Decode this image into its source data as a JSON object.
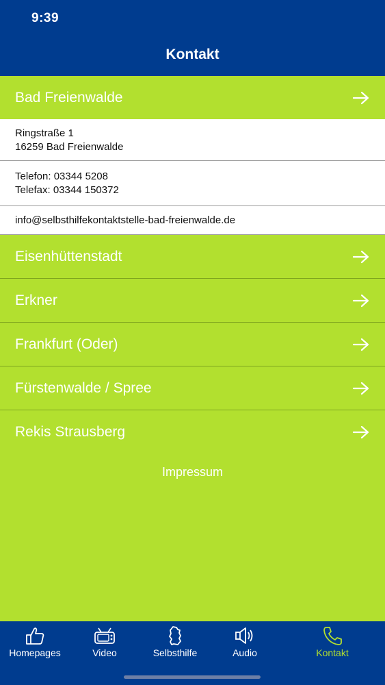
{
  "status_bar": {
    "time": "9:39"
  },
  "header": {
    "title": "Kontakt"
  },
  "expanded": {
    "name": "Bad Freienwalde",
    "address_line1": "Ringstraße 1",
    "address_line2": "16259 Bad Freienwalde",
    "phone": "Telefon: 03344 5208",
    "fax": "Telefax: 03344 150372",
    "email": "info@selbsthilfekontaktstelle-bad-freienwalde.de"
  },
  "locations": [
    "Eisenhüttenstadt",
    "Erkner",
    "Frankfurt (Oder)",
    "Fürstenwalde / Spree",
    "Rekis Strausberg"
  ],
  "impressum_label": "Impressum",
  "tabs": [
    {
      "label": "Homepages",
      "icon": "thumbs-up-icon"
    },
    {
      "label": "Video",
      "icon": "tv-icon"
    },
    {
      "label": "Selbsthilfe",
      "icon": "germany-map-icon"
    },
    {
      "label": "Audio",
      "icon": "speaker-icon"
    },
    {
      "label": "Kontakt",
      "icon": "phone-icon",
      "active": true
    }
  ],
  "colors": {
    "header": "#003c8f",
    "accent": "#b2e02f"
  }
}
